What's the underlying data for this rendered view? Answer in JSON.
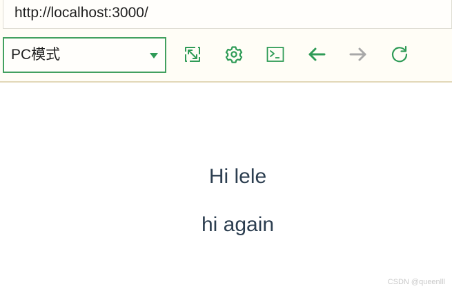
{
  "browser": {
    "url": "http://localhost:3000/",
    "device_mode": "PC模式"
  },
  "toolbar": {
    "icons": [
      "expand-icon",
      "gear-icon",
      "terminal-icon",
      "back-arrow-icon",
      "forward-arrow-icon",
      "refresh-icon"
    ],
    "accent_color": "#2f9b57",
    "disabled_color": "#a8a8a8"
  },
  "page": {
    "line1": "Hi lele",
    "line2": "hi again"
  },
  "watermark": "CSDN @queenlll"
}
